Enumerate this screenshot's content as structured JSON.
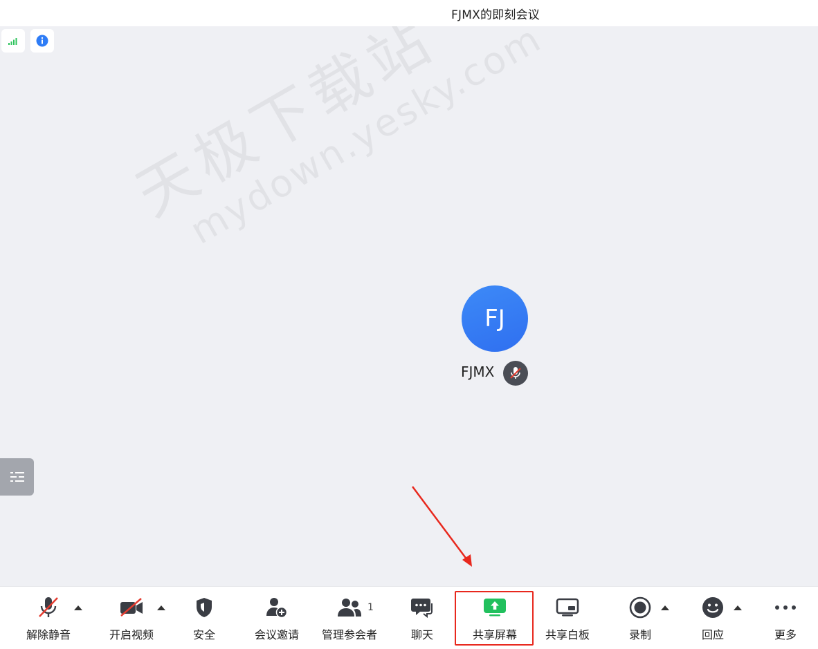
{
  "window": {
    "title": "FJMX的即刻会议"
  },
  "watermark": {
    "line1": "天极下载站",
    "line2": "mydown.yesky.com"
  },
  "participant": {
    "initials": "FJ",
    "name": "FJMX",
    "muted": true
  },
  "colors": {
    "avatar": "#3d86f6",
    "accent_green": "#21c05d",
    "highlight": "#e8281d",
    "toolbar_icon": "#3a3d44"
  },
  "toolbar": {
    "unmute": "解除静音",
    "start_video": "开启视频",
    "security": "安全",
    "invite": "会议邀请",
    "manage_participants": "管理参会者",
    "participant_count": "1",
    "chat": "聊天",
    "share_screen": "共享屏幕",
    "whiteboard": "共享白板",
    "record": "录制",
    "reactions": "回应",
    "more": "更多"
  },
  "icons": {
    "signal": "signal-strength-icon",
    "info": "info-icon",
    "side_panel": "list-panel-icon"
  }
}
